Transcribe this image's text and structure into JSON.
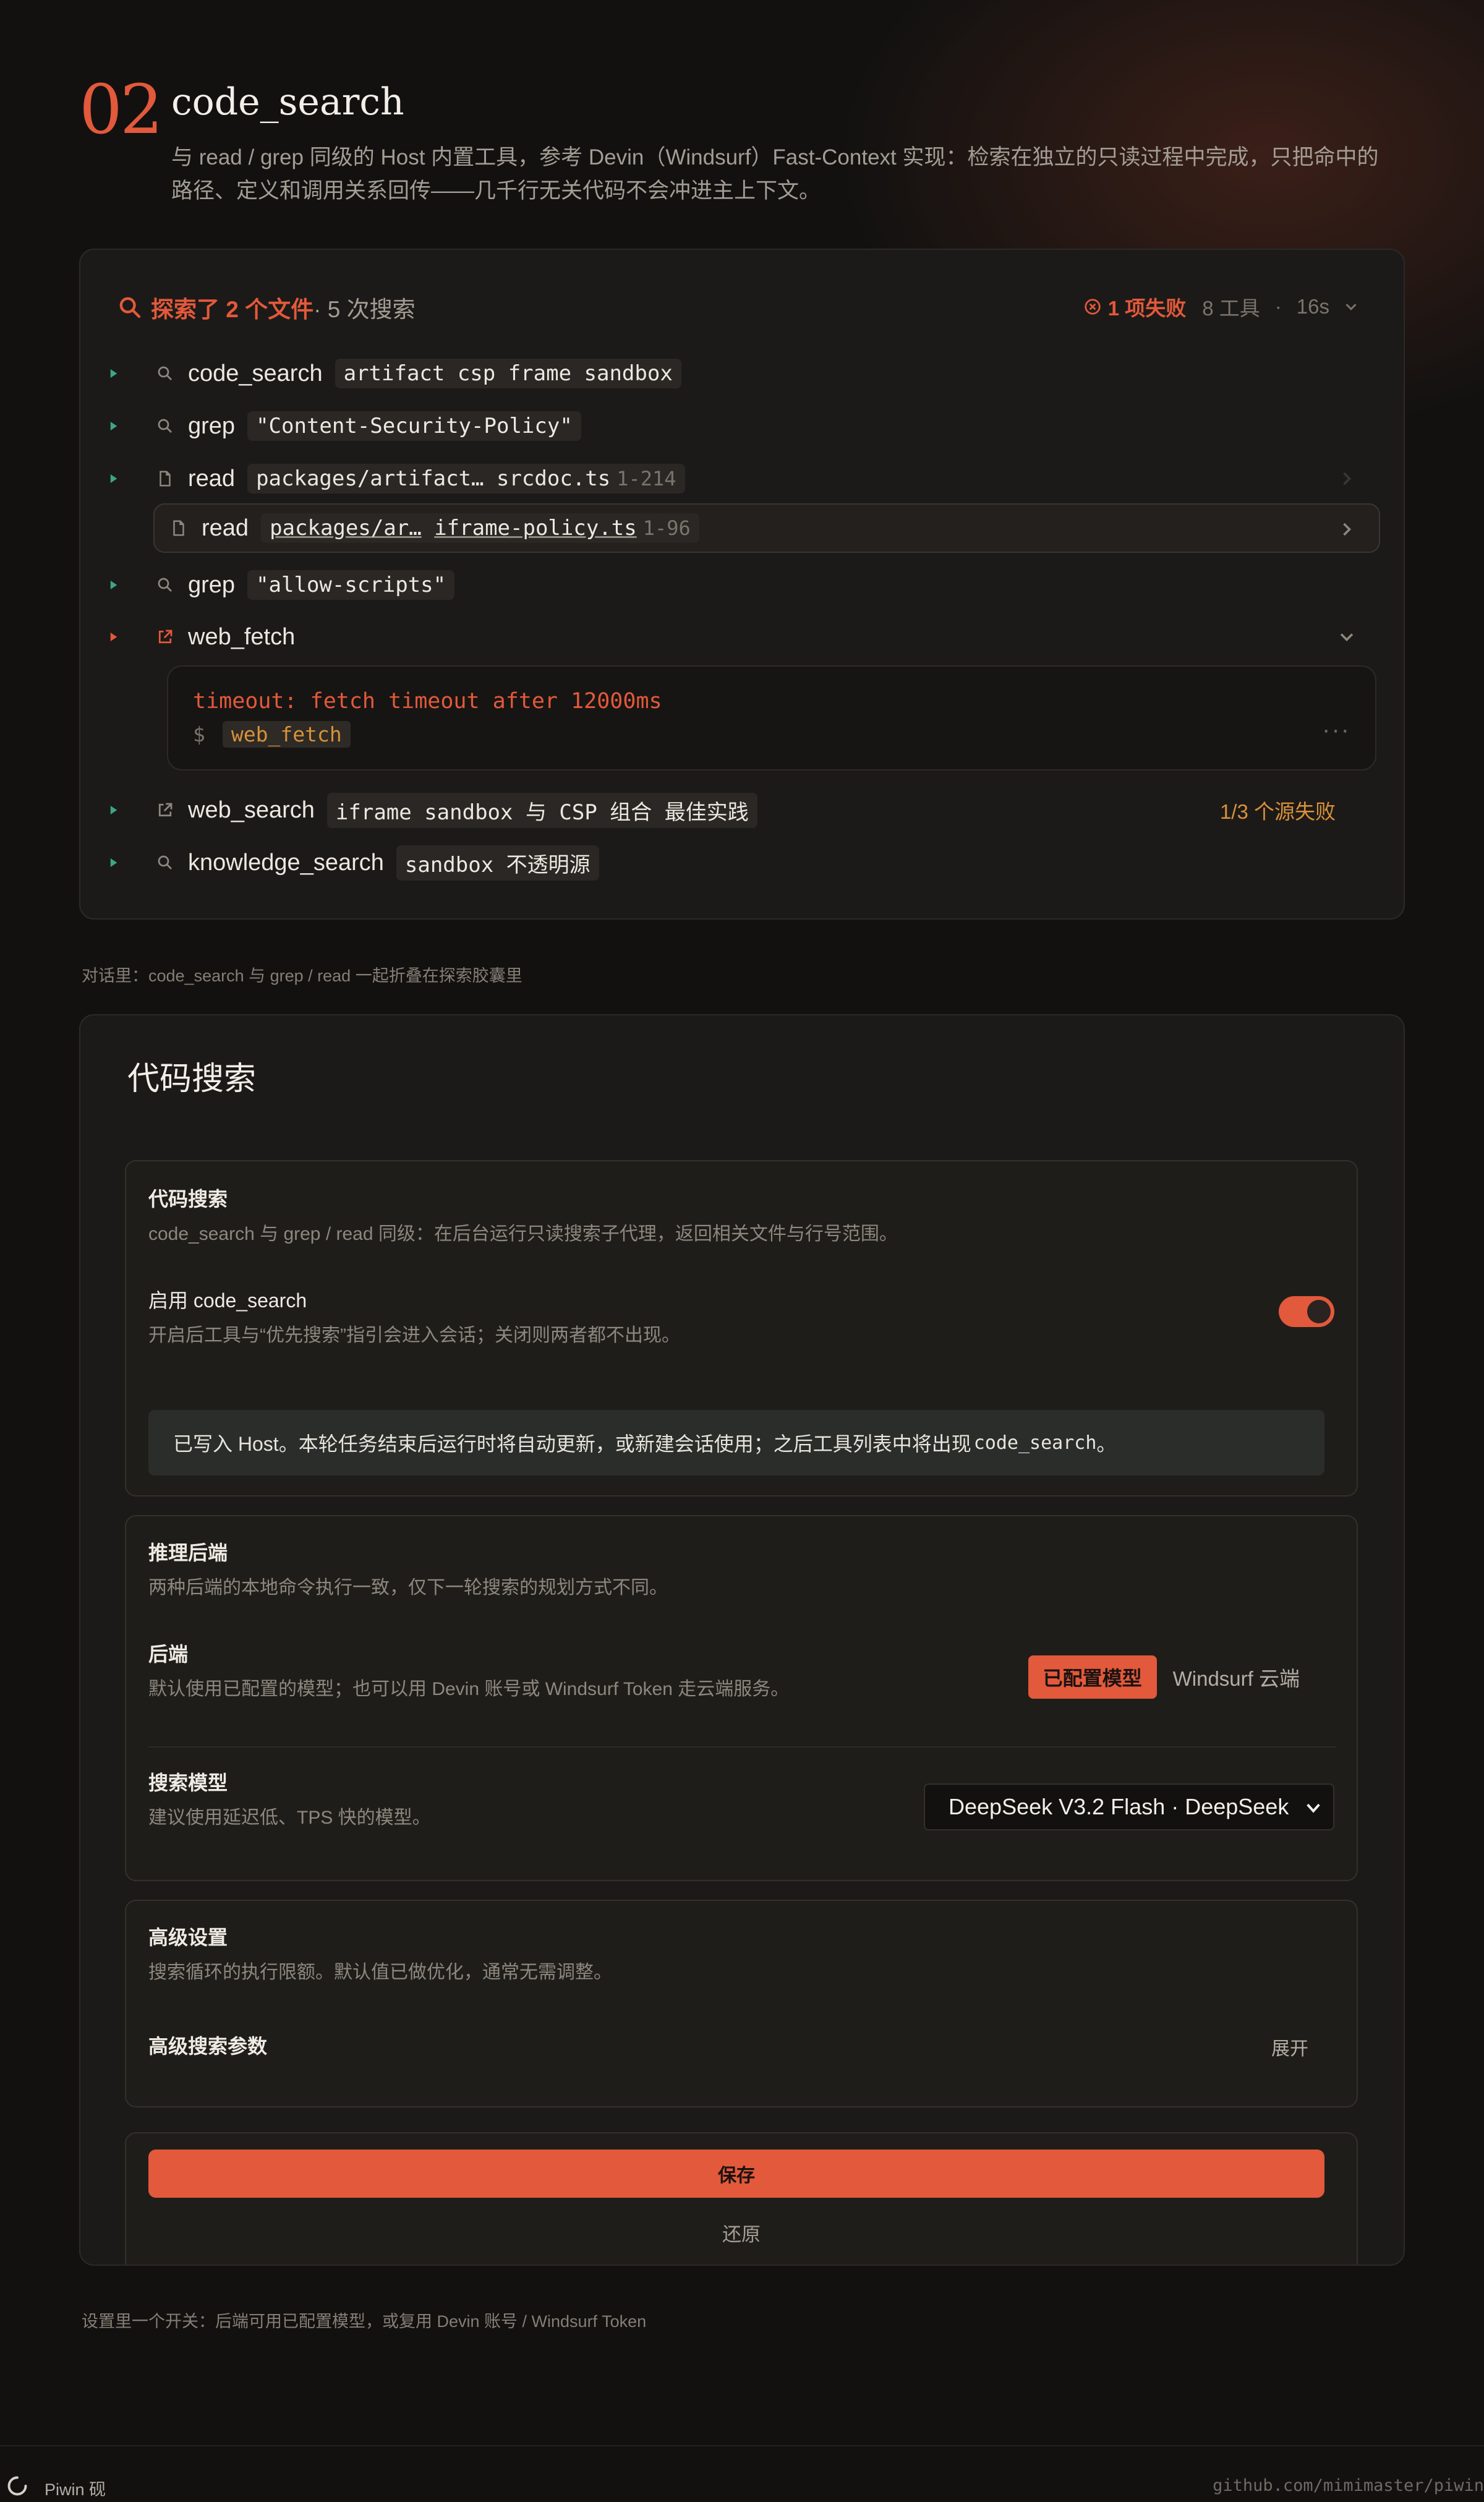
{
  "section": {
    "number": "02",
    "title": "code_search",
    "description": "与 read / grep 同级的 Host 内置工具，参考 Devin（Windsurf）Fast-Context 实现：检索在独立的只读过程中完成，只把命中的路径、定义和调用关系回传——几千行无关代码不会冲进主上下文。"
  },
  "explorer": {
    "summary_highlight": "探索了 2 个文件",
    "summary_rest": "· 5 次搜索",
    "fail_count": "1 项失败",
    "tools": "8 工具",
    "duration": "16s",
    "rows": [
      {
        "name": "code_search",
        "arg": "artifact csp frame sandbox"
      },
      {
        "name": "grep",
        "arg": "\"Content-Security-Policy\""
      },
      {
        "name": "read",
        "arg": "packages/artifact… srcdoc.ts",
        "range": "1-214"
      },
      {
        "name": "read",
        "arg_a": "packages/ar…",
        "arg_b": "iframe-policy.ts",
        "range": "1-96"
      },
      {
        "name": "grep",
        "arg": "\"allow-scripts\""
      },
      {
        "name": "web_fetch"
      },
      {
        "name": "web_search",
        "arg": "iframe sandbox 与 CSP 组合 最佳实践",
        "warn": "1/3 个源失败"
      },
      {
        "name": "knowledge_search",
        "arg": "sandbox 不透明源"
      }
    ],
    "error": {
      "message": "timeout: fetch timeout after 12000ms",
      "prompt": "$",
      "command": "web_fetch",
      "more": "···"
    },
    "caption": "对话里：code_search 与 grep / read 一起折叠在探索胶囊里"
  },
  "settings": {
    "title": "代码搜索",
    "card1": {
      "title": "代码搜索",
      "desc": "code_search 与 grep / read 同级：在后台运行只读搜索子代理，返回相关文件与行号范围。",
      "enable_label": "启用 code_search",
      "enable_desc": "开启后工具与“优先搜索”指引会进入会话；关闭则两者都不出现。",
      "enabled": true,
      "notice": "已写入 Host。本轮任务结束后运行时将自动更新，或新建会话使用；之后工具列表中将出现",
      "notice_code": "code_search",
      "notice_end": "。"
    },
    "card2": {
      "title": "推理后端",
      "desc": "两种后端的本地命令执行一致，仅下一轮搜索的规划方式不同。",
      "backend_label": "后端",
      "backend_desc": "默认使用已配置的模型；也可以用 Devin 账号或 Windsurf Token 走云端服务。",
      "backend_options": [
        "已配置模型",
        "Windsurf 云端"
      ],
      "backend_selected": "已配置模型",
      "model_label": "搜索模型",
      "model_desc": "建议使用延迟低、TPS 快的模型。",
      "model_value": "DeepSeek V3.2 Flash · DeepSeek"
    },
    "card3": {
      "title": "高级设置",
      "desc": "搜索循环的执行限额。默认值已做优化，通常无需调整。",
      "params_label": "高级搜索参数",
      "expand": "展开"
    },
    "save": "保存",
    "reset": "还原",
    "caption": "设置里一个开关：后端可用已配置模型，或复用 Devin 账号 / Windsurf Token"
  },
  "footer": {
    "brand": "Piwin 砚",
    "url": "github.com/mimimaster/piwin"
  },
  "colors": {
    "accent": "#e2593b",
    "success": "#3aa68a",
    "warning": "#d8913a",
    "background": "#121110",
    "panel": "#1c1a18"
  }
}
